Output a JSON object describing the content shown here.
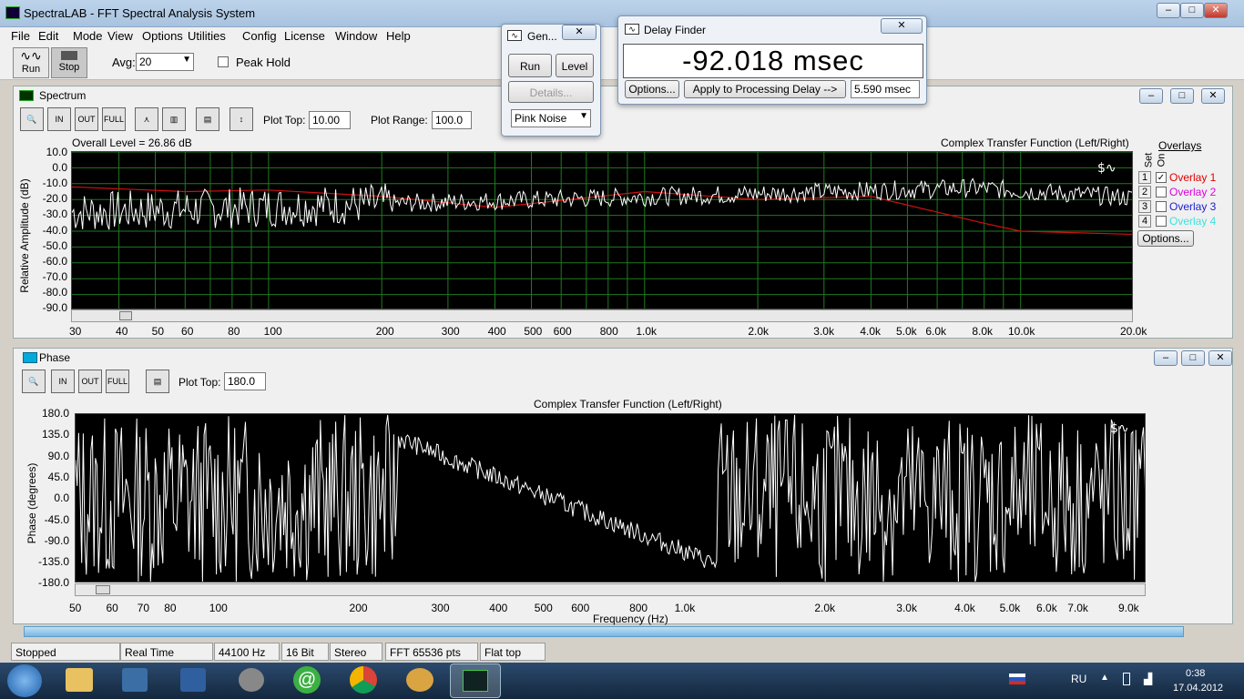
{
  "window": {
    "title": "SpectraLAB - FFT Spectral Analysis System"
  },
  "menu": [
    "File",
    "Edit",
    "Mode",
    "View",
    "Options",
    "Utilities",
    "Config",
    "License",
    "Window",
    "Help"
  ],
  "toolbar": {
    "run": "Run",
    "stop": "Stop",
    "avg_label": "Avg:",
    "avg_value": "20",
    "peak_hold": "Peak Hold"
  },
  "spectrum": {
    "title": "Spectrum",
    "plot_top_label": "Plot Top:",
    "plot_top": "10.00",
    "plot_range_label": "Plot Range:",
    "plot_range": "100.0",
    "overall": "Overall Level = 26.86 dB",
    "chart_title": "Complex Transfer Function (Left/Right)",
    "ylabel": "Relative Amplitude (dB)",
    "yticks": [
      "10.0",
      "0.0",
      "-10.0",
      "-20.0",
      "-30.0",
      "-40.0",
      "-50.0",
      "-60.0",
      "-70.0",
      "-80.0",
      "-90.0"
    ],
    "xticks": [
      "30",
      "40",
      "50",
      "60",
      "80",
      "100",
      "200",
      "300",
      "400",
      "500",
      "600",
      "800",
      "1.0k",
      "2.0k",
      "3.0k",
      "4.0k",
      "5.0k",
      "6.0k",
      "8.0k",
      "10.0k",
      "20.0k"
    ],
    "overlays": {
      "title": "Overlays",
      "set": "Set",
      "on": "On",
      "items": [
        {
          "n": "1",
          "label": "Overlay 1",
          "color": "#e00000",
          "checked": true
        },
        {
          "n": "2",
          "label": "Overlay 2",
          "color": "#e000e0",
          "checked": false
        },
        {
          "n": "3",
          "label": "Overlay 3",
          "color": "#2020d0",
          "checked": false
        },
        {
          "n": "4",
          "label": "Overlay 4",
          "color": "#40e0e0",
          "checked": false
        }
      ],
      "options": "Options..."
    }
  },
  "phase": {
    "title": "Phase",
    "plot_top_label": "Plot Top:",
    "plot_top": "180.0",
    "chart_title": "Complex Transfer Function (Left/Right)",
    "ylabel": "Phase (degrees)",
    "xlabel": "Frequency (Hz)",
    "yticks": [
      "180.0",
      "135.0",
      "90.0",
      "45.0",
      "0.0",
      "-45.0",
      "-90.0",
      "-135.0",
      "-180.0"
    ],
    "xticks": [
      "50",
      "60",
      "70",
      "80",
      "100",
      "200",
      "300",
      "400",
      "500",
      "600",
      "800",
      "1.0k",
      "2.0k",
      "3.0k",
      "4.0k",
      "5.0k",
      "6.0k",
      "7.0k",
      "9.0k"
    ]
  },
  "generator": {
    "title": "Gen...",
    "run": "Run",
    "level": "Level",
    "details": "Details...",
    "signal": "Pink Noise"
  },
  "delay_finder": {
    "title": "Delay Finder",
    "value": "-92.018 msec",
    "options": "Options...",
    "apply": "Apply to Processing Delay -->",
    "apply_value": "5.590 msec"
  },
  "status": [
    "Stopped",
    "Real Time",
    "44100 Hz",
    "16 Bit",
    "Stereo",
    "FFT 65536 pts",
    "Flat top"
  ],
  "taskbar": {
    "lang": "RU",
    "time": "0:38",
    "date": "17.04.2012"
  },
  "chart_data": [
    {
      "type": "line",
      "title": "Complex Transfer Function (Left/Right)",
      "ylabel": "Relative Amplitude (dB)",
      "ylim": [
        -90,
        10
      ],
      "xscale": "log",
      "xlim": [
        30,
        20000
      ],
      "series": [
        {
          "name": "Overlay 1",
          "color": "#e00000",
          "x": [
            30,
            60,
            100,
            200,
            400,
            1000,
            2000,
            4000,
            6000,
            8000,
            10000,
            20000
          ],
          "values": [
            -12,
            -15,
            -14,
            -18,
            -25,
            -15,
            -20,
            -18,
            -28,
            -35,
            -40,
            -42
          ]
        }
      ]
    },
    {
      "type": "line",
      "title": "Complex Transfer Function (Left/Right)",
      "ylabel": "Phase (degrees)",
      "xlabel": "Frequency (Hz)",
      "ylim": [
        -180,
        180
      ],
      "xscale": "log",
      "xlim": [
        50,
        9000
      ]
    }
  ]
}
